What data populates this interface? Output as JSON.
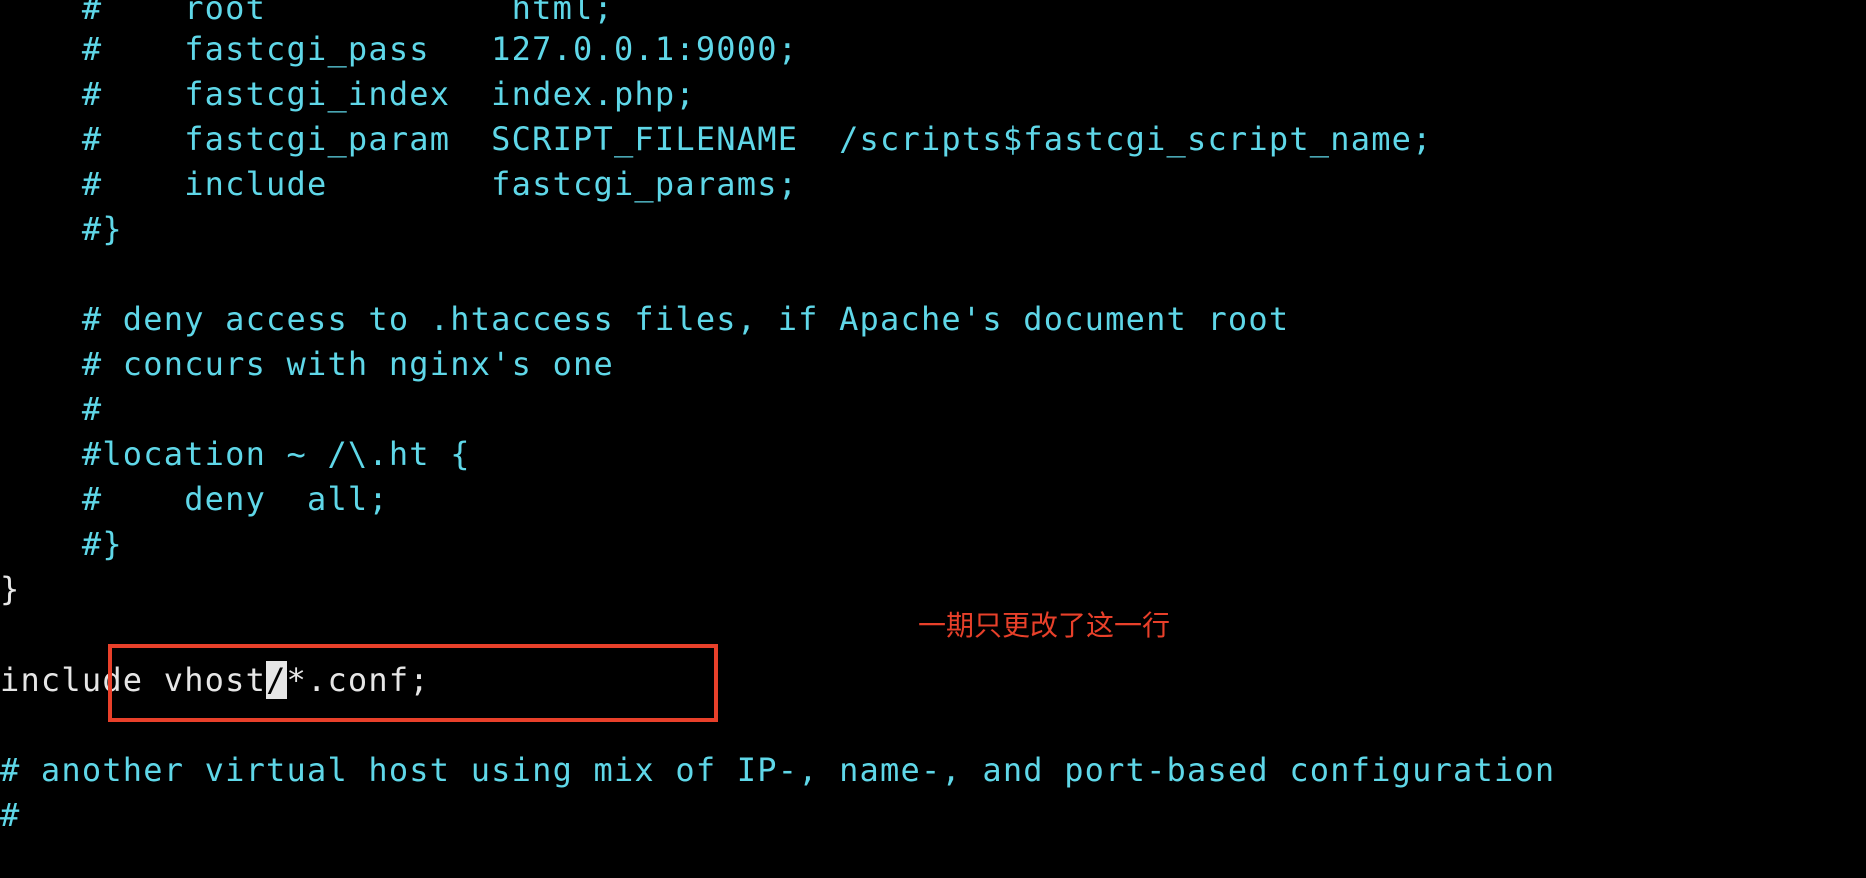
{
  "terminal": {
    "lines": [
      "    #    root            html;",
      "    #    fastcgi_pass   127.0.0.1:9000;",
      "    #    fastcgi_index  index.php;",
      "    #    fastcgi_param  SCRIPT_FILENAME  /scripts$fastcgi_script_name;",
      "    #    include        fastcgi_params;",
      "    #}",
      "",
      "    # deny access to .htaccess files, if Apache's document root",
      "    # concurs with nginx's one",
      "    #",
      "    #location ~ /\\.ht {",
      "    #    deny  all;",
      "    #}",
      "}",
      "",
      "",
      "",
      "# another virtual host using mix of IP-, name-, and port-based configuration",
      "#"
    ],
    "edited_line": {
      "before_cursor": "include vhost",
      "cursor_char": "/",
      "after_cursor": "*.conf;"
    }
  },
  "annotation": {
    "text": "一期只更改了这一行"
  },
  "colors": {
    "background": "#000000",
    "comment_text": "#5fd7e8",
    "plain_text": "#e6e6e6",
    "annotation": "#e8402a"
  }
}
